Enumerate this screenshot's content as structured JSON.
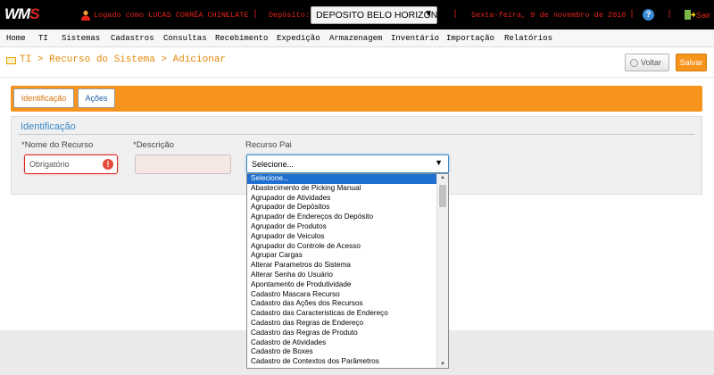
{
  "app": {
    "logo_w": "WM",
    "logo_s": "S"
  },
  "topbar": {
    "user_text": "Logado como LUCAS CORRÊA CHINELATE",
    "deposit_label": "Depósito:",
    "deposit_value": "DEPOSITO BELO HORIZONTE",
    "date_text": "Sexta-feira, 9 de novembro de 2018",
    "help_glyph": "?",
    "exit_label": "Sair",
    "accent_color": "#e5231a"
  },
  "menu": [
    "Home",
    "TI",
    "Sistemas",
    "Cadastros",
    "Consultas",
    "Recebimento",
    "Expedição",
    "Armazenagem",
    "Inventário",
    "Importação",
    "Relatórios"
  ],
  "breadcrumb": "TI > Recurso do Sistema > Adicionar",
  "buttons": {
    "voltar": "Voltar",
    "salvar": "Salvar"
  },
  "tabs": [
    "Identificação",
    "Ações"
  ],
  "form": {
    "section": "Identificação",
    "nome_label": "*Nome do Recurso",
    "nome_placeholder": "Obrigatório",
    "descricao_label": "*Descrição",
    "pai_label": "Recurso Pai",
    "pai_value": "Selecione..."
  },
  "dropdown": {
    "selected_index": 0,
    "options": [
      "Selecione...",
      "Abastecimento de Picking Manual",
      "Agrupador de Atividades",
      "Agrupador de Depósitos",
      "Agrupador de Endereços do Depósito",
      "Agrupador de Produtos",
      "Agrupador de Veiculos",
      "Agrupador do Controle de Acesso",
      "Agrupar Cargas",
      "Alterar Parametros do Sistema",
      "Alterar Senha do Usuário",
      "Apontamento de Produtividade",
      "Cadastro Mascara Recurso",
      "Cadastro das Ações dos Recursos",
      "Cadastro das Caracteristicas de Endereço",
      "Cadastro das Regras de Endereço",
      "Cadastro das Regras de Produto",
      "Cadastro de Atividades",
      "Cadastro de Boxes",
      "Cadastro de Contextos dos Parâmetros"
    ]
  }
}
